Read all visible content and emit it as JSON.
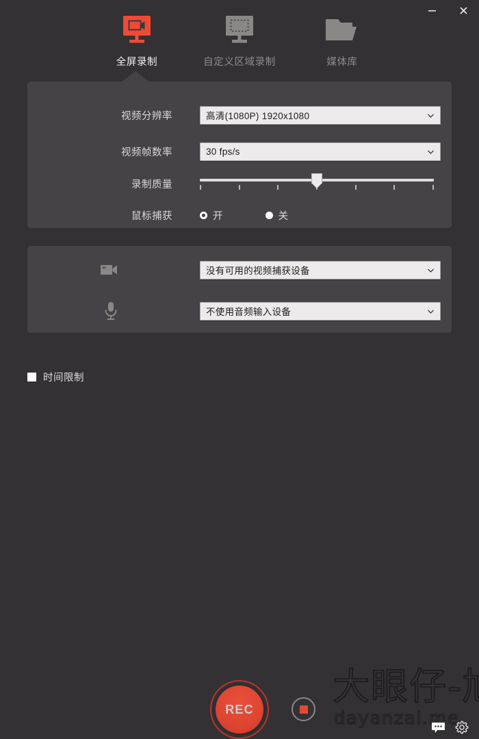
{
  "window": {
    "minimize_label": "—",
    "close_label": "✕"
  },
  "tabs": [
    {
      "label": "全屏录制",
      "icon": "monitor-camera-icon",
      "active": true
    },
    {
      "label": "自定义区域录制",
      "icon": "monitor-region-icon",
      "active": false
    },
    {
      "label": "媒体库",
      "icon": "folder-icon",
      "active": false
    }
  ],
  "settings": {
    "resolution": {
      "label": "视频分辨率",
      "value": "高清(1080P)   1920x1080"
    },
    "framerate": {
      "label": "视频帧数率",
      "value": "30 fps/s"
    },
    "quality": {
      "label": "录制质量",
      "ticks": 7,
      "value_index": 3
    },
    "mouse_capture": {
      "label": "鼠标捕获",
      "on_label": "开",
      "off_label": "关",
      "selected": "开"
    }
  },
  "devices": {
    "video": {
      "icon": "camcorder-icon",
      "value": "没有可用的视频捕获设备"
    },
    "audio": {
      "icon": "microphone-icon",
      "value": "不使用音频输入设备"
    }
  },
  "bottom": {
    "time_limit_label": "时间限制",
    "time_limit_checked": false,
    "record_label": "REC",
    "stop_label": "",
    "chat_icon": "speech-bubble-icon",
    "settings_icon": "gear-icon"
  },
  "watermark": {
    "cn": "大眼仔-旭",
    "en": "dayanzai.me"
  },
  "colors": {
    "window_bg": "#333133",
    "panel_bg": "#454345",
    "accent_red": "#f04a37",
    "rec_red": "#df4632",
    "label_text": "#d9d7d7",
    "inactive_tab": "#8e8c8c",
    "combo_bg": "#eceaea"
  }
}
